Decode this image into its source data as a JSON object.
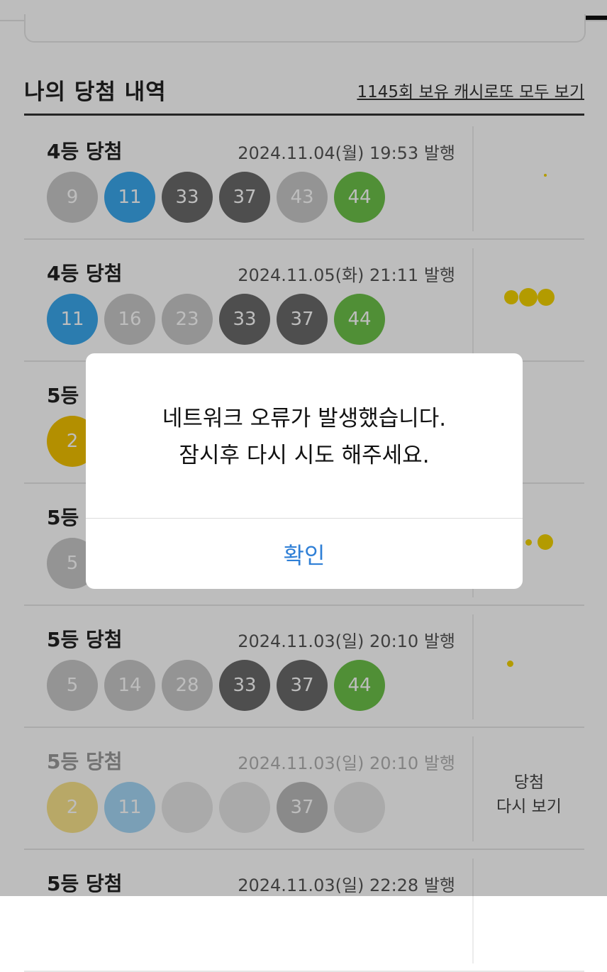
{
  "header": {
    "section_title": "나의 당첨 내역",
    "view_all_link": "1145회 보유 캐시로또 모두 보기"
  },
  "entries": [
    {
      "rank": "4등 당첨",
      "issued": "2024.11.04(월) 19:53 발행",
      "balls": [
        "9",
        "11",
        "33",
        "37",
        "43",
        "44"
      ],
      "colors": [
        "#c8c8c8",
        "#3aa8ec",
        "#6a6a6a",
        "#6a6a6a",
        "#c8c8c8",
        "#6cc24a"
      ],
      "side_label": ""
    },
    {
      "rank": "4등 당첨",
      "issued": "2024.11.05(화) 21:11 발행",
      "balls": [
        "11",
        "16",
        "23",
        "33",
        "37",
        "44"
      ],
      "colors": [
        "#3aa8ec",
        "#c8c8c8",
        "#c8c8c8",
        "#6a6a6a",
        "#6a6a6a",
        "#6cc24a"
      ],
      "side_label": ""
    },
    {
      "rank": "5등 당첨",
      "issued": "",
      "balls": [
        "2"
      ],
      "colors": [
        "#f2c200"
      ],
      "side_label": ""
    },
    {
      "rank": "5등 당첨",
      "issued": "",
      "balls": [
        "5"
      ],
      "colors": [
        "#c8c8c8"
      ],
      "side_label": ""
    },
    {
      "rank": "5등 당첨",
      "issued": "2024.11.03(일) 20:10 발행",
      "balls": [
        "5",
        "14",
        "28",
        "33",
        "37",
        "44"
      ],
      "colors": [
        "#c8c8c8",
        "#c8c8c8",
        "#c8c8c8",
        "#6a6a6a",
        "#6a6a6a",
        "#6cc24a"
      ],
      "side_label": ""
    },
    {
      "rank": "5등 당첨",
      "issued": "2024.11.03(일) 20:10 발행",
      "balls": [
        "2",
        "11",
        "",
        "",
        "37",
        ""
      ],
      "colors": [
        "#f2c200",
        "#3aa8ec",
        "#c8c8c8",
        "#c8c8c8",
        "#6a6a6a",
        "#c8c8c8"
      ],
      "side_label": "당첨\n다시 보기"
    },
    {
      "rank": "5등 당첨",
      "issued": "2024.11.03(일) 22:28 발행",
      "balls": [],
      "colors": [],
      "side_label": ""
    }
  ],
  "dialog": {
    "message_line1": "네트워크 오류가 발생했습니다.",
    "message_line2": "잠시후 다시 시도 해주세요.",
    "confirm_label": "확인"
  },
  "colors": {
    "ball_yellow": "#f2c200",
    "ball_blue": "#3aa8ec",
    "ball_gray": "#c8c8c8",
    "ball_dark": "#6a6a6a",
    "ball_green": "#6cc24a",
    "confirm_text": "#2f7fd6"
  }
}
